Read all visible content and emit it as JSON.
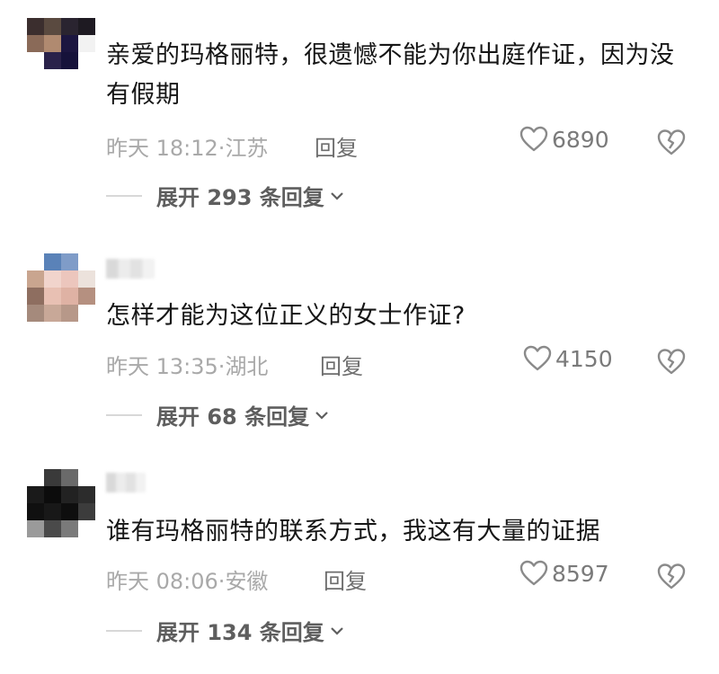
{
  "comments": [
    {
      "text": "亲爱的玛格丽特，很遗憾不能为你出庭作证，因为没有假期",
      "time": "昨天 18:12",
      "location": "江苏",
      "reply_label": "回复",
      "likes": "6890",
      "expand_label": "展开 293 条回复"
    },
    {
      "text": "怎样才能为这位正义的女士作证?",
      "time": "昨天 13:35",
      "location": "湖北",
      "reply_label": "回复",
      "likes": "4150",
      "expand_label": "展开 68 条回复"
    },
    {
      "text": "谁有玛格丽特的联系方式，我这有大量的证据",
      "time": "昨天 08:06",
      "location": "安徽",
      "reply_label": "回复",
      "likes": "8597",
      "expand_label": "展开 134 条回复"
    }
  ],
  "icons": {
    "like": "heart-outline-icon",
    "dislike": "broken-heart-icon",
    "expand": "chevron-down-icon"
  },
  "colors": {
    "text": "#161616",
    "meta": "#a9a9a9",
    "reply": "#6d6d6d",
    "expand": "#5e5e5e"
  }
}
